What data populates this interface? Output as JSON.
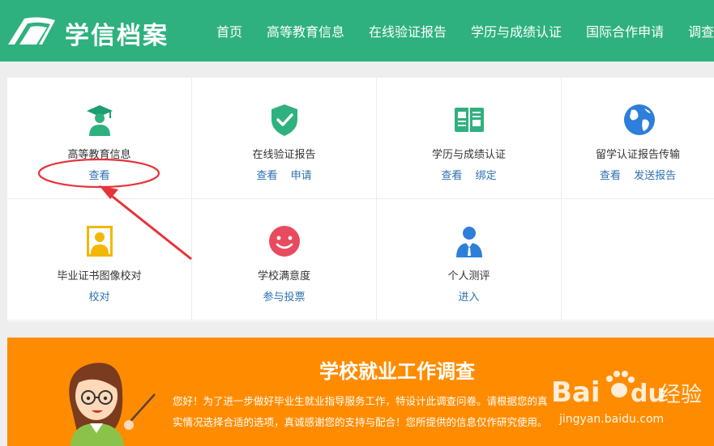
{
  "header": {
    "logo_text": "学信档案",
    "nav": [
      "首页",
      "高等教育信息",
      "在线验证报告",
      "学历与成绩认证",
      "国际合作申请",
      "调查/"
    ]
  },
  "services": [
    {
      "label": "高等教育信息",
      "links": [
        "查看"
      ],
      "icon": "graduate-icon"
    },
    {
      "label": "在线验证报告",
      "links": [
        "查看",
        "申请"
      ],
      "icon": "shield-check-icon"
    },
    {
      "label": "学历与成绩认证",
      "links": [
        "查看",
        "绑定"
      ],
      "icon": "book-icon"
    },
    {
      "label": "留学认证报告传输",
      "links": [
        "查看",
        "发送报告"
      ],
      "icon": "globe-icon"
    },
    {
      "label": "毕业证书图像校对",
      "links": [
        "校对"
      ],
      "icon": "portrait-icon"
    },
    {
      "label": "学校满意度",
      "links": [
        "参与投票"
      ],
      "icon": "smiley-icon"
    },
    {
      "label": "个人测评",
      "links": [
        "进入"
      ],
      "icon": "person-icon"
    }
  ],
  "banner": {
    "title": "学校就业工作调查",
    "line1": "您好！为了进一步做好毕业生就业指导服务工作，特设计此调查问卷。请根据您的真",
    "line2": "实情况选择合适的选项，真诚感谢您的支持与配合！您所提供的信息仅作研究使用。"
  },
  "watermark": {
    "brand": "Bai",
    "brand2": "du",
    "cn": "经验",
    "url": "jingyan.baidu.com"
  },
  "colors": {
    "header": "#2eb17e",
    "link": "#2c6fb3",
    "banner": "#ff8c00",
    "annotation": "#e8333a"
  }
}
